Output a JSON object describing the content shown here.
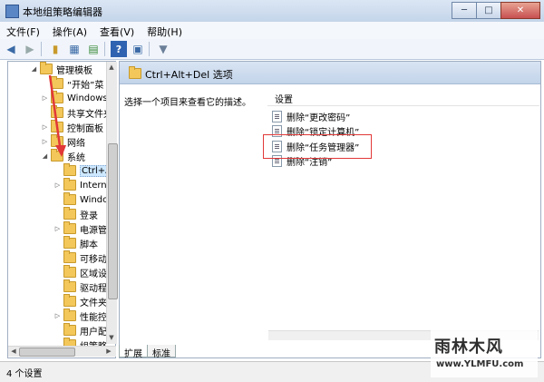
{
  "window": {
    "title": "本地组策略编辑器",
    "controls": {
      "minimize": "─",
      "maximize": "□",
      "close": "✕"
    }
  },
  "menu": [
    "文件(F)",
    "操作(A)",
    "查看(V)",
    "帮助(H)"
  ],
  "toolbar_icons": [
    "back-icon",
    "forward-icon",
    "up-folder-icon",
    "show-hide-tree-icon",
    "export-icon",
    "help-icon",
    "properties-icon",
    "filter-icon"
  ],
  "tree": {
    "items": [
      {
        "label": "管理模板",
        "arrow": "◢"
      },
      {
        "label": "“开始”菜",
        "arrow": ""
      },
      {
        "label": "Windows",
        "arrow": "▷"
      },
      {
        "label": "共享文件夹",
        "arrow": ""
      },
      {
        "label": "控制面板",
        "arrow": "▷"
      },
      {
        "label": "网络",
        "arrow": "▷"
      },
      {
        "label": "系统",
        "arrow": "◢"
      },
      {
        "label": "Ctrl+A",
        "arrow": ""
      },
      {
        "label": "Intern",
        "arrow": "▷"
      },
      {
        "label": "Windo",
        "arrow": ""
      },
      {
        "label": "登录",
        "arrow": ""
      },
      {
        "label": "电源管",
        "arrow": "▷"
      },
      {
        "label": "脚本",
        "arrow": ""
      },
      {
        "label": "可移动",
        "arrow": ""
      },
      {
        "label": "区域设",
        "arrow": ""
      },
      {
        "label": "驱动程",
        "arrow": ""
      },
      {
        "label": "文件夹",
        "arrow": ""
      },
      {
        "label": "性能控",
        "arrow": "▷"
      },
      {
        "label": "用户配",
        "arrow": ""
      },
      {
        "label": "组策略",
        "arrow": ""
      }
    ]
  },
  "right": {
    "header": "Ctrl+Alt+Del 选项",
    "description": "选择一个项目来查看它的描述。",
    "column": "设置",
    "settings": [
      "删除“更改密码”",
      "删除“锁定计算机”",
      "删除“任务管理器”",
      "删除“注销”"
    ]
  },
  "tabs": [
    "扩展",
    "标准"
  ],
  "status": "4 个设置",
  "watermark": {
    "line1": "雨林木风",
    "line2": "www.YLMFU.com"
  },
  "colors": {
    "highlight": "#e23838",
    "arrow": "#e23838"
  }
}
